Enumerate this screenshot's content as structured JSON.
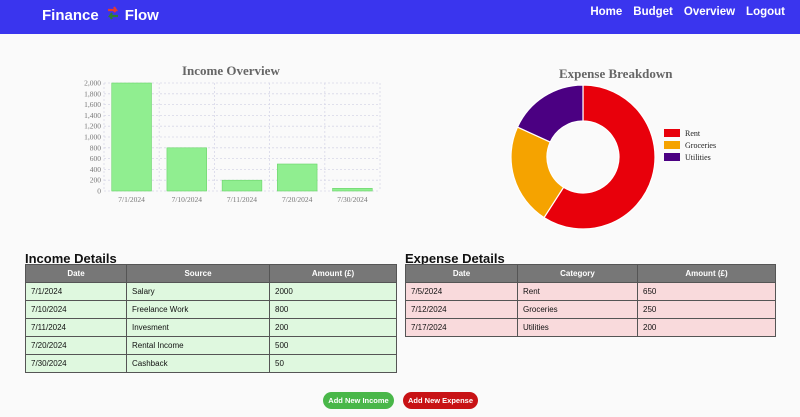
{
  "navbar": {
    "brand_left": "Finance",
    "brand_right": "Flow",
    "links": [
      "Home",
      "Budget",
      "Overview",
      "Logout"
    ]
  },
  "income_chart": {
    "title": "Income Overview",
    "chart_data": {
      "type": "bar",
      "categories": [
        "7/1/2024",
        "7/10/2024",
        "7/11/2024",
        "7/20/2024",
        "7/30/2024"
      ],
      "values": [
        2000,
        800,
        200,
        500,
        50
      ],
      "ylim": [
        0,
        2000
      ],
      "yticks": [
        "0",
        "200",
        "400",
        "600",
        "800",
        "1,000",
        "1,200",
        "1,400",
        "1,600",
        "1,800",
        "2,000"
      ],
      "color": "#90ee90",
      "grid": true
    }
  },
  "expense_chart": {
    "title": "Expense Breakdown",
    "chart_data": {
      "type": "pie",
      "labels": [
        "Rent",
        "Groceries",
        "Utilities"
      ],
      "values": [
        650,
        250,
        200
      ],
      "colors": [
        "#e8000b",
        "#f5a300",
        "#4b0082"
      ],
      "donut": true,
      "legend": "right"
    }
  },
  "income_details": {
    "title": "Income Details",
    "headers": [
      "Date",
      "Source",
      "Amount (£)"
    ],
    "rows": [
      [
        "7/1/2024",
        "Salary",
        "2000"
      ],
      [
        "7/10/2024",
        "Freelance Work",
        "800"
      ],
      [
        "7/11/2024",
        "Invesment",
        "200"
      ],
      [
        "7/20/2024",
        "Rental Income",
        "500"
      ],
      [
        "7/30/2024",
        "Cashback",
        "50"
      ]
    ]
  },
  "expense_details": {
    "title": "Expense Details",
    "headers": [
      "Date",
      "Category",
      "Amount (£)"
    ],
    "rows": [
      [
        "7/5/2024",
        "Rent",
        "650"
      ],
      [
        "7/12/2024",
        "Groceries",
        "250"
      ],
      [
        "7/17/2024",
        "Utilities",
        "200"
      ]
    ]
  },
  "actions": {
    "add_income": "Add New Income",
    "add_expense": "Add New Expense"
  }
}
